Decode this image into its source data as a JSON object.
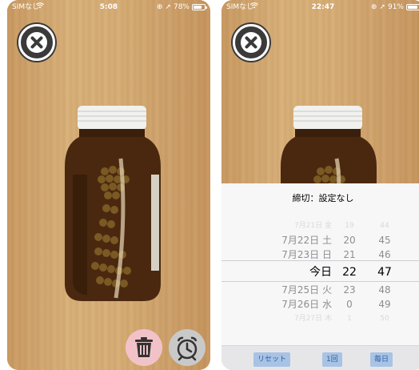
{
  "left": {
    "status": {
      "carrier": "SIMなし",
      "time": "5:08",
      "battery_text": "78%",
      "battery_level": 0.78
    },
    "actions": {
      "trash_icon": "trash-icon",
      "alarm_icon": "alarm-clock-icon"
    }
  },
  "right": {
    "status": {
      "carrier": "SIMなし",
      "time": "22:47",
      "battery_text": "91%",
      "battery_level": 0.91
    },
    "deadline": "締切：設定なし",
    "picker": {
      "dates": [
        "7月21日 金",
        "7月22日 土",
        "7月23日 日",
        "今日",
        "7月25日 火",
        "7月26日 水",
        "7月27日 木"
      ],
      "hours": [
        "19",
        "20",
        "21",
        "22",
        "23",
        "0",
        "1"
      ],
      "minutes": [
        "44",
        "45",
        "46",
        "47",
        "48",
        "49",
        "50"
      ],
      "selected_index": 3
    },
    "footer": {
      "reset": "リセット",
      "once": "1回",
      "daily": "毎日"
    }
  },
  "colors": {
    "close_bg": "#3a3a3a",
    "trash_bg": "#f1c3c8",
    "alarm_bg": "#c9c9c9",
    "footer_btn_bg": "#a8c3e4",
    "footer_btn_text": "#2b5fa8"
  }
}
